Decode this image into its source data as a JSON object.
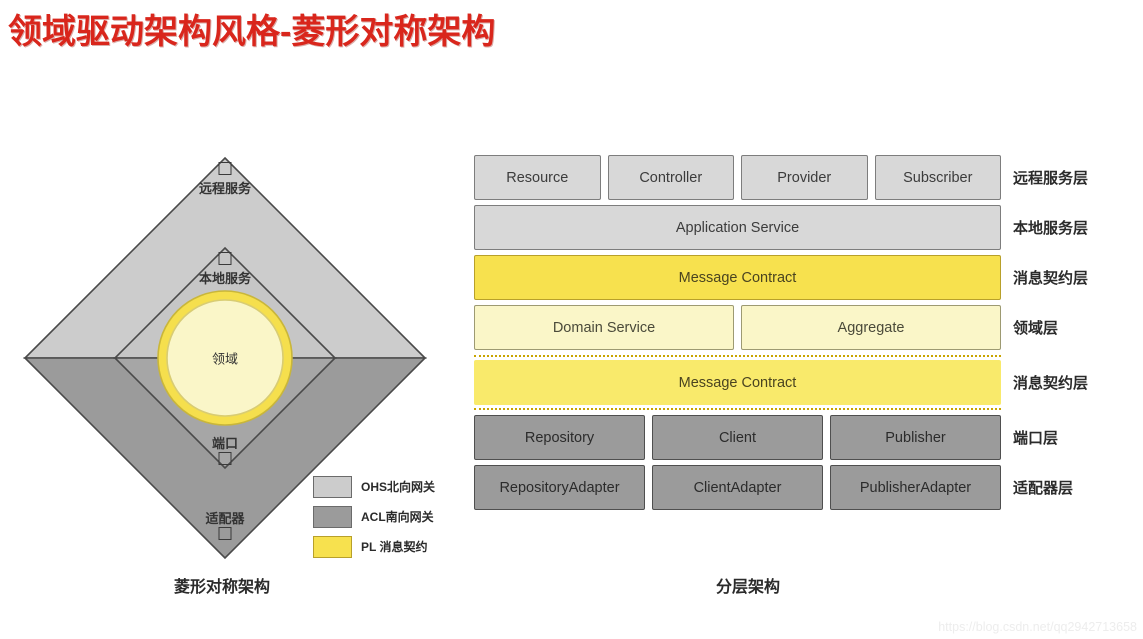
{
  "title": "领域驱动架构风格-菱形对称架构",
  "diamond": {
    "caption": "菱形对称架构",
    "center_label": "领域",
    "rings": [
      {
        "label": "远程服务",
        "port_icon": "square-port-icon"
      },
      {
        "label": "本地服务",
        "port_icon": "square-port-icon"
      },
      {
        "label": "端口",
        "port_icon": "square-port-icon"
      },
      {
        "label": "适配器",
        "port_icon": "square-port-icon"
      }
    ],
    "colors": {
      "outer_north": "#CCCCCC",
      "inner_north": "#C4C4C4",
      "outer_south": "#9B9B9B",
      "inner_south": "#A8A8A8",
      "core_fill": "#FAF6C8",
      "core_ring": "#F5DF4D",
      "stroke": "#4a4a4a"
    }
  },
  "legend": {
    "items": [
      {
        "label": "OHS北向网关",
        "color": "#CCCCCC"
      },
      {
        "label": "ACL南向网关",
        "color": "#9B9B9B"
      },
      {
        "label": "PL  消息契约",
        "color": "#F7E14E"
      }
    ]
  },
  "layers": {
    "caption": "分层架构",
    "rows": [
      {
        "style": "gray-light",
        "name": "远程服务层",
        "cells": [
          {
            "label": "Resource",
            "flex": 1
          },
          {
            "label": "Controller",
            "flex": 1
          },
          {
            "label": "Provider",
            "flex": 1
          },
          {
            "label": "Subscriber",
            "flex": 1
          }
        ]
      },
      {
        "style": "gray-light",
        "name": "本地服务层",
        "cells": [
          {
            "label": "Application Service",
            "flex": 1
          }
        ]
      },
      {
        "style": "yellow-strong",
        "name": "消息契约层",
        "cells": [
          {
            "label": "Message Contract",
            "flex": 1
          }
        ]
      },
      {
        "style": "yellow-pale",
        "name": "领域层",
        "cells": [
          {
            "label": "Domain Service",
            "flex": 1
          },
          {
            "label": "Aggregate",
            "flex": 1
          }
        ]
      },
      {
        "style": "yellow-dotted",
        "name": "消息契约层",
        "cells": [
          {
            "label": "Message Contract",
            "flex": 1
          }
        ]
      },
      {
        "style": "gray-dark",
        "name": "端口层",
        "cells": [
          {
            "label": "Repository",
            "flex": 1
          },
          {
            "label": "Client",
            "flex": 1
          },
          {
            "label": "Publisher",
            "flex": 1
          }
        ]
      },
      {
        "style": "gray-dark",
        "name": "适配器层",
        "cells": [
          {
            "label": "RepositoryAdapter",
            "flex": 1
          },
          {
            "label": "ClientAdapter",
            "flex": 1
          },
          {
            "label": "PublisherAdapter",
            "flex": 1
          }
        ]
      }
    ]
  },
  "watermark": "https://blog.csdn.net/qq2942713658"
}
